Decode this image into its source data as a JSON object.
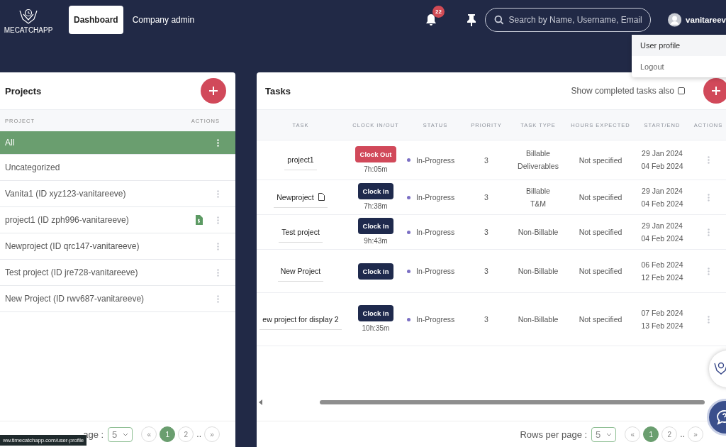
{
  "header": {
    "logo_text": "MECATCHAPP",
    "nav": [
      {
        "label": "Dashboard",
        "selected": true
      },
      {
        "label": "Company admin",
        "selected": false
      }
    ],
    "notifications_count": "22",
    "search": {
      "placeholder": "Search by Name, Username, Email"
    },
    "username": "vanitareev"
  },
  "user_menu": [
    {
      "label": "User profile",
      "selected": true
    },
    {
      "label": "Logout",
      "selected": false
    }
  ],
  "projects": {
    "title": "Projects",
    "columns": [
      "PROJECT",
      "ACTIONS"
    ],
    "rows": [
      {
        "name": "All",
        "selected": true,
        "has_invoice": false,
        "has_menu": true
      },
      {
        "name": "Uncategorized",
        "selected": false,
        "has_invoice": false,
        "has_menu": false
      },
      {
        "name": "Vanita1 (ID xyz123-vanitareeve)",
        "selected": false,
        "has_invoice": false,
        "has_menu": true
      },
      {
        "name": "project1 (ID zph996-vanitareeve)",
        "selected": false,
        "has_invoice": true,
        "has_menu": true
      },
      {
        "name": "Newproject (ID qrc147-vanitareeve)",
        "selected": false,
        "has_invoice": false,
        "has_menu": true
      },
      {
        "name": "Test project (ID jre728-vanitareeve)",
        "selected": false,
        "has_invoice": false,
        "has_menu": true
      },
      {
        "name": "New Project (ID rwv687-vanitareeve)",
        "selected": false,
        "has_invoice": false,
        "has_menu": true
      }
    ],
    "pagination": {
      "rows_label": "age :",
      "per_page": "5",
      "prev": "«",
      "next": "»",
      "ellipsis": "..",
      "pages": [
        {
          "label": "1",
          "selected": true
        },
        {
          "label": "2",
          "selected": false
        }
      ]
    }
  },
  "tasks": {
    "title": "Tasks",
    "show_completed": {
      "label": "Show completed tasks also",
      "checked": false
    },
    "columns": [
      "TASK",
      "CLOCK IN/OUT",
      "STATUS",
      "PRIORITY",
      "TASK TYPE",
      "HOURS EXPECTED",
      "START/END",
      "ACTIONS"
    ],
    "rows": [
      {
        "task": "project1",
        "has_note": false,
        "clock": {
          "kind": "out",
          "label": "Clock Out"
        },
        "timer": "7h:05m",
        "status": "In-Progress",
        "priority": "3",
        "task_type": [
          "Billable",
          "Deliverables"
        ],
        "hours": "Not specified",
        "start": "29 Jan 2024",
        "end": "04 Feb 2024"
      },
      {
        "task": "Newproject",
        "has_note": true,
        "clock": {
          "kind": "in",
          "label": "Clock In"
        },
        "timer": "7h:38m",
        "status": "In-Progress",
        "priority": "3",
        "task_type": [
          "Billable",
          "T&M"
        ],
        "hours": "Not specified",
        "start": "29 Jan 2024",
        "end": "04 Feb 2024"
      },
      {
        "task": "Test project",
        "has_note": false,
        "clock": {
          "kind": "in",
          "label": "Clock In"
        },
        "timer": "9h:43m",
        "status": "In-Progress",
        "priority": "3",
        "task_type": [
          "Non-Billable"
        ],
        "hours": "Not specified",
        "start": "29 Jan 2024",
        "end": "04 Feb 2024"
      },
      {
        "task": "New Project",
        "has_note": false,
        "clock": {
          "kind": "in",
          "label": "Clock In"
        },
        "status": "In-Progress",
        "priority": "3",
        "task_type": [
          "Non-Billable"
        ],
        "hours": "Not specified",
        "start": "06 Feb 2024",
        "end": "12 Feb 2024"
      },
      {
        "task": "ew project for display 2",
        "has_note": false,
        "clock": {
          "kind": "in",
          "label": "Clock In"
        },
        "timer": "10h:35m",
        "status": "In-Progress",
        "priority": "3",
        "task_type": [
          "Non-Billable"
        ],
        "hours": "Not specified",
        "start": "07 Feb 2024",
        "end": "13 Feb 2024"
      }
    ],
    "pagination": {
      "rows_label": "Rows per page :",
      "per_page": "5",
      "prev": "«",
      "next": "»",
      "ellipsis": "..",
      "pages": [
        {
          "label": "1",
          "selected": true
        },
        {
          "label": "2",
          "selected": false
        }
      ]
    }
  },
  "status_url": "ww.timecatchapp.com/user-profile"
}
